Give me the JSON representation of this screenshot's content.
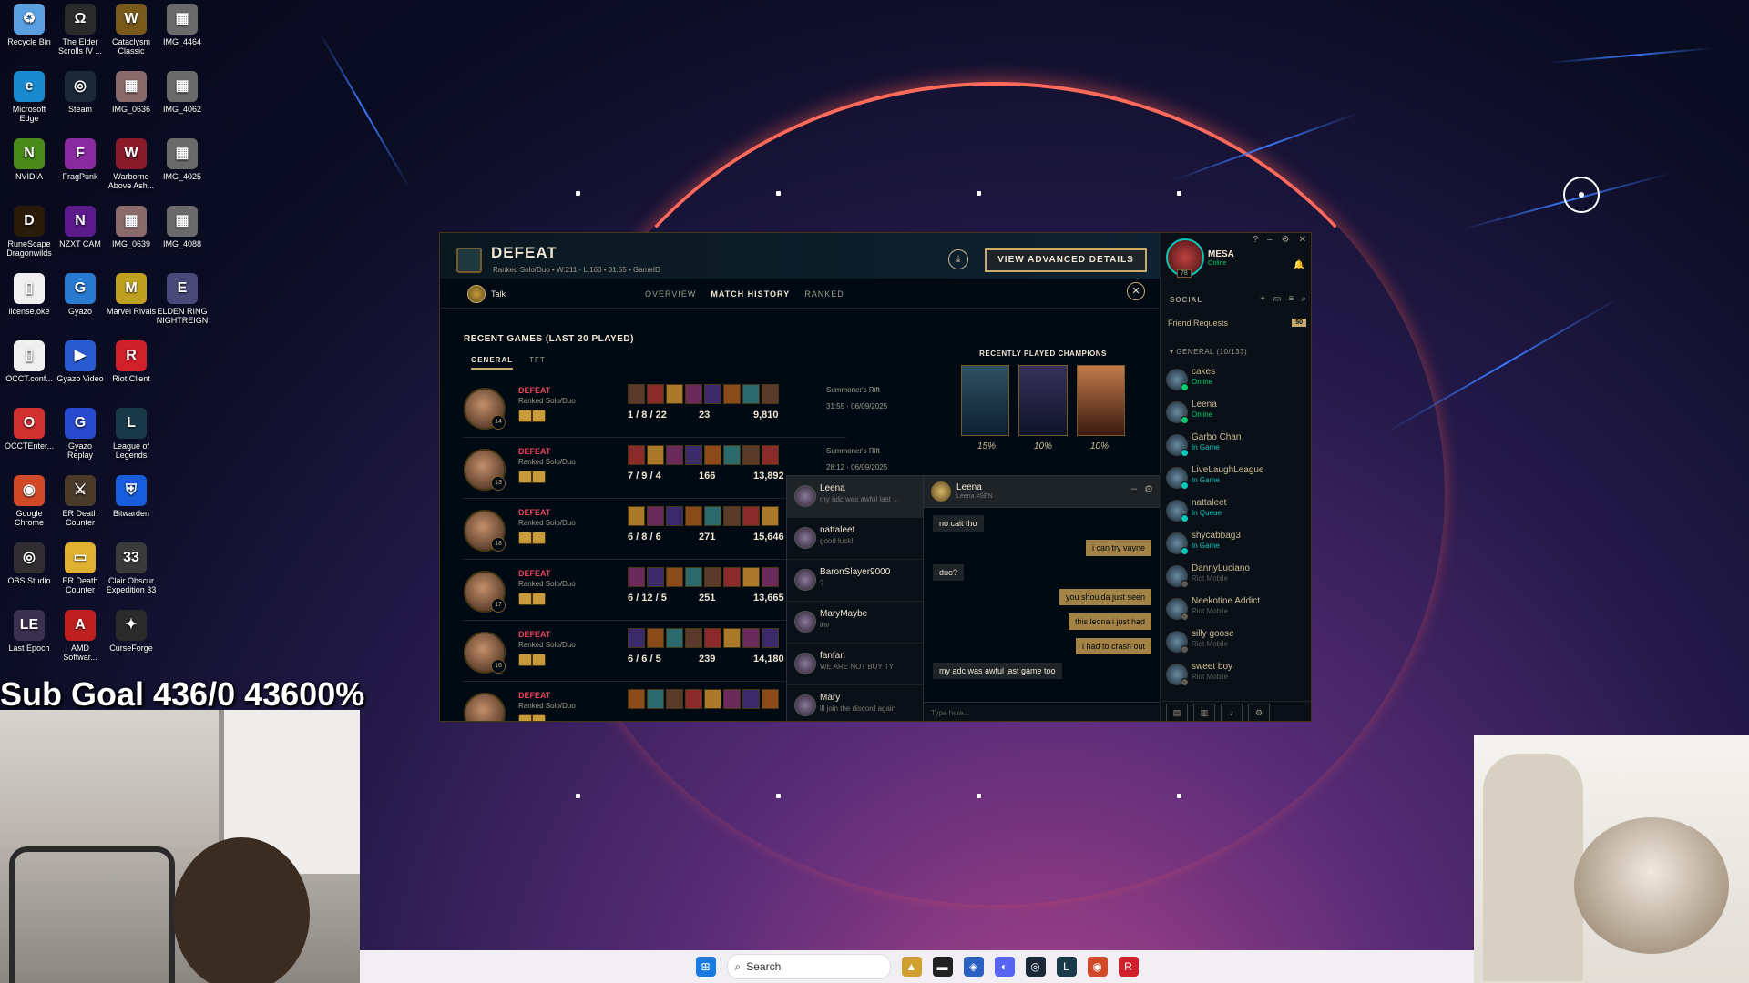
{
  "desktop": {
    "icons": [
      {
        "label": "Recycle Bin",
        "icon": "recycle-bin-icon",
        "color": "#5aa0e0",
        "glyph": "♻"
      },
      {
        "label": "The Elder Scrolls IV ...",
        "icon": "elder-scrolls-icon",
        "color": "#2a2a2a",
        "glyph": "Ω"
      },
      {
        "label": "Cataclysm Classic",
        "icon": "wow-icon",
        "color": "#7a5a1a",
        "glyph": "W"
      },
      {
        "label": "IMG_4464",
        "icon": "image-file-icon",
        "color": "#6a6a6a",
        "glyph": "▦"
      },
      {
        "label": "Microsoft Edge",
        "icon": "edge-icon",
        "color": "#1a8ad0",
        "glyph": "e"
      },
      {
        "label": "Steam",
        "icon": "steam-icon",
        "color": "#1b2838",
        "glyph": "◎"
      },
      {
        "label": "IMG_0636",
        "icon": "image-file-icon",
        "color": "#8a6a6a",
        "glyph": "▦"
      },
      {
        "label": "IMG_4062",
        "icon": "image-file-icon",
        "color": "#6a6a6a",
        "glyph": "▦"
      },
      {
        "label": "NVIDIA",
        "icon": "nvidia-icon",
        "color": "#4a8a1a",
        "glyph": "N"
      },
      {
        "label": "FragPunk",
        "icon": "fragpunk-icon",
        "color": "#8a2aa0",
        "glyph": "F"
      },
      {
        "label": "Warborne Above Ash...",
        "icon": "warborne-icon",
        "color": "#8a1a2a",
        "glyph": "W"
      },
      {
        "label": "IMG_4025",
        "icon": "image-file-icon",
        "color": "#6a6a6a",
        "glyph": "▦"
      },
      {
        "label": "RuneScape Dragonwilds",
        "icon": "runescape-icon",
        "color": "#2a1a0a",
        "glyph": "D"
      },
      {
        "label": "NZXT CAM",
        "icon": "nzxt-icon",
        "color": "#5a1a8a",
        "glyph": "N"
      },
      {
        "label": "IMG_0639",
        "icon": "image-file-icon",
        "color": "#8a6a6a",
        "glyph": "▦"
      },
      {
        "label": "IMG_4088",
        "icon": "image-file-icon",
        "color": "#6a6a6a",
        "glyph": "▦"
      },
      {
        "label": "license.oke",
        "icon": "file-icon",
        "color": "#f0f0f0",
        "glyph": "▯"
      },
      {
        "label": "Gyazo",
        "icon": "gyazo-icon",
        "color": "#2a7ad0",
        "glyph": "G"
      },
      {
        "label": "Marvel Rivals",
        "icon": "marvel-rivals-icon",
        "color": "#c0a020",
        "glyph": "M"
      },
      {
        "label": "ELDEN RING NIGHTREIGN",
        "icon": "elden-ring-icon",
        "color": "#4a4a7a",
        "glyph": "E"
      },
      {
        "label": "OCCT.conf...",
        "icon": "file-icon",
        "color": "#f0f0f0",
        "glyph": "▯"
      },
      {
        "label": "Gyazo Video",
        "icon": "gyazo-video-icon",
        "color": "#2a5ad0",
        "glyph": "▶"
      },
      {
        "label": "Riot Client",
        "icon": "riot-client-icon",
        "color": "#d0202a",
        "glyph": "R"
      },
      {
        "label": "",
        "icon": "",
        "color": "transparent",
        "glyph": ""
      },
      {
        "label": "OCCTEnter...",
        "icon": "occt-icon",
        "color": "#d03030",
        "glyph": "O"
      },
      {
        "label": "Gyazo Replay",
        "icon": "gyazo-replay-icon",
        "color": "#2a4ad0",
        "glyph": "G"
      },
      {
        "label": "League of Legends",
        "icon": "league-icon",
        "color": "#1a3a4a",
        "glyph": "L"
      },
      {
        "label": "",
        "icon": "",
        "color": "transparent",
        "glyph": ""
      },
      {
        "label": "Google Chrome",
        "icon": "chrome-icon",
        "color": "#d04a2a",
        "glyph": "◉"
      },
      {
        "label": "ER Death Counter",
        "icon": "er-death-icon",
        "color": "#4a3a2a",
        "glyph": "⚔"
      },
      {
        "label": "Bitwarden",
        "icon": "bitwarden-icon",
        "color": "#175ddc",
        "glyph": "⛨"
      },
      {
        "label": "",
        "icon": "",
        "color": "transparent",
        "glyph": ""
      },
      {
        "label": "OBS Studio",
        "icon": "obs-icon",
        "color": "#302e31",
        "glyph": "◎"
      },
      {
        "label": "ER Death Counter",
        "icon": "folder-icon",
        "color": "#e0b030",
        "glyph": "▭"
      },
      {
        "label": "Clair Obscur Expedition 33",
        "icon": "clair-obscur-icon",
        "color": "#3a3a3a",
        "glyph": "33"
      },
      {
        "label": "",
        "icon": "",
        "color": "transparent",
        "glyph": ""
      },
      {
        "label": "Last Epoch",
        "icon": "last-epoch-icon",
        "color": "#3a3050",
        "glyph": "LE"
      },
      {
        "label": "AMD Softwar...",
        "icon": "amd-icon",
        "color": "#c02020",
        "glyph": "A"
      },
      {
        "label": "CurseForge",
        "icon": "curseforge-icon",
        "color": "#2a2a2a",
        "glyph": "✦"
      },
      {
        "label": "",
        "icon": "",
        "color": "transparent",
        "glyph": ""
      }
    ]
  },
  "overlay": {
    "goal_text": "Sub Goal 436/0 43600%"
  },
  "taskbar": {
    "search_placeholder": "Search"
  },
  "client": {
    "header": {
      "title": "DEFEAT",
      "subtitle": "Ranked Solo/Duo  •  W:211 - L:160  •  31:55  •  GameID",
      "advanced_button": "VIEW ADVANCED DETAILS"
    },
    "talk_label": "Talk",
    "tabs": [
      "OVERVIEW",
      "MATCH HISTORY",
      "RANKED"
    ],
    "active_tab": 1,
    "recent_title": "RECENT GAMES (LAST 20 PLAYED)",
    "subtabs": [
      "GENERAL",
      "TFT"
    ],
    "games": [
      {
        "result": "DEFEAT",
        "mode": "Ranked Solo/Duo",
        "level": "14",
        "kda": "1 / 8 / 22",
        "cs": "23",
        "gold": "9,810",
        "map": "Summoner's Rift",
        "time": "31:55  ·  06/09/2025"
      },
      {
        "result": "DEFEAT",
        "mode": "Ranked Solo/Duo",
        "level": "13",
        "kda": "7 / 9 / 4",
        "cs": "166",
        "gold": "13,892",
        "map": "Summoner's Rift",
        "time": "28:12  ·  06/09/2025"
      },
      {
        "result": "DEFEAT",
        "mode": "Ranked Solo/Duo",
        "level": "18",
        "kda": "6 / 8 / 6",
        "cs": "271",
        "gold": "15,646",
        "map": "",
        "time": ""
      },
      {
        "result": "DEFEAT",
        "mode": "Ranked Solo/Duo",
        "level": "17",
        "kda": "6 / 12 / 5",
        "cs": "251",
        "gold": "13,665",
        "map": "",
        "time": ""
      },
      {
        "result": "DEFEAT",
        "mode": "Ranked Solo/Duo",
        "level": "16",
        "kda": "6 / 6 / 5",
        "cs": "239",
        "gold": "14,180",
        "map": "",
        "time": ""
      },
      {
        "result": "DEFEAT",
        "mode": "Ranked Solo/Duo",
        "level": "17",
        "kda": "",
        "cs": "",
        "gold": "",
        "map": "",
        "time": ""
      }
    ],
    "recently_played_title": "RECENTLY PLAYED CHAMPIONS",
    "recently_played_pcts": [
      "15%",
      "10%",
      "10%"
    ],
    "chat_list": [
      {
        "name": "Leena",
        "msg": "my adc was awful last ..."
      },
      {
        "name": "nattaleet",
        "msg": "good luck!"
      },
      {
        "name": "BaronSlayer9000",
        "msg": "?"
      },
      {
        "name": "MaryMaybe",
        "msg": "inv"
      },
      {
        "name": "fanfan",
        "msg": "WE ARE NOT BUY TY"
      },
      {
        "name": "Mary",
        "msg": "ill join the discord again"
      }
    ],
    "chat_window": {
      "name": "Leena",
      "tag": "Leena #SEN",
      "messages": [
        {
          "text": "no cait tho",
          "dir": "in"
        },
        {
          "text": "i can try vayne",
          "dir": "out"
        },
        {
          "text": "duo?",
          "dir": "in"
        },
        {
          "text": "you shoulda just seen",
          "dir": "out"
        },
        {
          "text": "this leona i just had",
          "dir": "out"
        },
        {
          "text": "i had to crash out",
          "dir": "out"
        },
        {
          "text": "my adc was awful last game too",
          "dir": "in"
        }
      ],
      "input_placeholder": "Type here..."
    },
    "social": {
      "name": "MESA",
      "status": "Online",
      "level": "78",
      "section": "SOCIAL",
      "friend_requests": "Friend Requests",
      "friend_requests_count": "50",
      "group": "GENERAL (10/133)",
      "friends": [
        {
          "name": "cakes",
          "status": "Online",
          "kind": "online"
        },
        {
          "name": "Leena",
          "status": "Online",
          "kind": "online"
        },
        {
          "name": "Garbo Chan",
          "status": "In Game",
          "kind": "ingame"
        },
        {
          "name": "LiveLaughLeague",
          "status": "In Game",
          "kind": "ingame"
        },
        {
          "name": "nattaleet",
          "status": "In Queue",
          "kind": "ingame"
        },
        {
          "name": "shycabbag3",
          "status": "In Game",
          "kind": "ingame"
        },
        {
          "name": "DannyLuciano",
          "status": "Riot Mobile",
          "kind": "mobile"
        },
        {
          "name": "Neekotine Addict",
          "status": "Riot Mobile",
          "kind": "mobile"
        },
        {
          "name": "silly goose",
          "status": "Riot Mobile",
          "kind": "mobile"
        },
        {
          "name": "sweet boy",
          "status": "Riot Mobile",
          "kind": "mobile"
        }
      ]
    }
  }
}
